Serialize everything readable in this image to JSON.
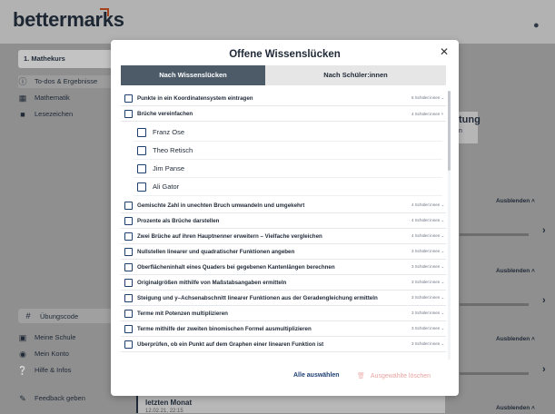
{
  "app": {
    "logo": "bettermarks",
    "bell_icon": "bell-icon"
  },
  "sidebar": {
    "course": "1. Mathekurs",
    "items": [
      {
        "label": "To-dos & Ergebnisse",
        "icon": "info-icon"
      },
      {
        "label": "Mathematik",
        "icon": "grid-icon"
      },
      {
        "label": "Lesezeichen",
        "icon": "bookmark-icon"
      }
    ],
    "code": "Übungscode",
    "bottom_items": [
      {
        "label": "Meine Schule",
        "icon": "school-icon"
      },
      {
        "label": "Mein Konto",
        "icon": "account-icon"
      },
      {
        "label": "Hilfe & Infos",
        "icon": "help-icon"
      },
      {
        "label": "Feedback geben",
        "icon": "feedback-icon"
      }
    ]
  },
  "background": {
    "partial_heading": "tung",
    "partial_sub": "n",
    "hide_label": "Ausblenden",
    "last_month": "letzten Monat",
    "last_month_date": "12.02.21, 22:15"
  },
  "modal": {
    "title": "Offene Wissenslücken",
    "tabs": [
      "Nach Wissenslücken",
      "Nach Schüler:innen"
    ],
    "rows": [
      {
        "label": "Punkte in ein Koordinatensystem eintragen",
        "count": "6 Schüler:innen",
        "chevron": "chevron-down-icon"
      },
      {
        "label": "Brüche vereinfachen",
        "count": "4 Schüler:innen",
        "chevron": "chevron-up-icon"
      },
      {
        "label": "Gemischte Zahl in unechten Bruch umwandeln und umgekehrt",
        "count": "4 Schüler:innen",
        "chevron": "chevron-down-icon"
      },
      {
        "label": "Prozente als Brüche darstellen",
        "count": "4 Schüler:innen",
        "chevron": "chevron-down-icon"
      },
      {
        "label": "Zwei Brüche auf ihren Hauptnenner erweitern – Vielfache vergleichen",
        "count": "4 Schüler:innen",
        "chevron": "chevron-down-icon"
      },
      {
        "label": "Nullstellen linearer und quadratischer Funktionen angeben",
        "count": "3 Schüler:innen",
        "chevron": "chevron-down-icon"
      },
      {
        "label": "Oberflächeninhalt eines Quaders bei gegebenen Kantenlängen berechnen",
        "count": "3 Schüler:innen",
        "chevron": "chevron-down-icon"
      },
      {
        "label": "Originalgrößen mithilfe von Maßstabsangaben ermitteln",
        "count": "3 Schüler:innen",
        "chevron": "chevron-down-icon"
      },
      {
        "label": "Steigung und y–Achsenabschnitt linearer Funktionen aus der Geradengleichung ermitteln",
        "count": "3 Schüler:innen",
        "chevron": "chevron-down-icon"
      },
      {
        "label": "Terme mit Potenzen multiplizieren",
        "count": "3 Schüler:innen",
        "chevron": "chevron-down-icon"
      },
      {
        "label": "Terme mithilfe der zweiten binomischen Formel ausmultiplizieren",
        "count": "3 Schüler:innen",
        "chevron": "chevron-down-icon"
      },
      {
        "label": "Überprüfen, ob ein Punkt auf dem Graphen einer linearen Funktion ist",
        "count": "3 Schüler:innen",
        "chevron": "chevron-down-icon"
      }
    ],
    "students": [
      "Franz Ose",
      "Theo Retisch",
      "Jim Panse",
      "Ali Gator"
    ],
    "select_all": "Alle auswählen",
    "delete_selected": "Ausgewählte löschen"
  }
}
